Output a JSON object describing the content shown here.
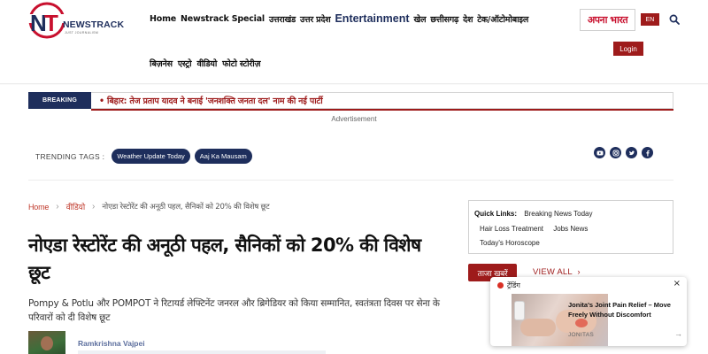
{
  "header": {
    "logo_text": "NEWSTRACK",
    "logo_tagline": "JUST JOURNALISM",
    "nav_items": [
      "Home",
      "Newstrack Special",
      "उत्तराखंड",
      "उत्तर प्रदेश",
      "Entertainment",
      "खेल",
      "छत्तीसगढ़",
      "देश",
      "टेक/ऑटोमोबाइल"
    ],
    "nav_items_row2": [
      "बिज़नेस",
      "एस्ट्रो",
      "वीडियो",
      "फोटो स्टोरीज़"
    ],
    "apna_bharat": "अपना भारत",
    "language": "EN",
    "login": "Login"
  },
  "breaking": {
    "label": "BREAKING",
    "text": "• बिहार: तेज प्रताप यादव ने बनाई 'जनशक्ति जनता दल' नाम की नई पार्टी"
  },
  "advertisement": "Advertisement",
  "trending": {
    "label": "TRENDING TAGS :",
    "tags": [
      "Weather Update Today",
      "Aaj Ka Mausam"
    ]
  },
  "socials": [
    "youtube-icon",
    "instagram-icon",
    "twitter-icon",
    "facebook-icon"
  ],
  "breadcrumb": {
    "home": "Home",
    "section": "वीडियो",
    "current": "नोएडा रेस्टोरेंट की अनूठी पहल, सैनिकों को 20% की विशेष छूट"
  },
  "article": {
    "title": "नोएडा रेस्टोरेंट की अनूठी पहल, सैनिकों को 20% की विशेष छूट",
    "summary": "Pompy & Potlu और POMPOT ने रिटायर्ड लेफ्टिनेंट जनरल और ब्रिगेडियर को किया सम्मानित, स्वतंत्रता दिवस पर सेना के परिवारों को दी विशेष छूट",
    "author": "Ramkrishna Vajpei"
  },
  "quick_links": {
    "label": "Quick Links:",
    "links": [
      "Breaking News Today",
      "Hair Loss Treatment",
      "Jobs News",
      "Today's Horoscope"
    ]
  },
  "latest": {
    "label": "ताजा खबरें",
    "view_all": "VIEW ALL"
  },
  "popup": {
    "title": "ट्रेंडिंग",
    "close": "×",
    "ad_title": "Jonita's Joint Pain Relief – Move Freely Without Discomfort",
    "brand": "JONITAS",
    "arrow": "→"
  },
  "colors": {
    "navy": "#1e2e5c",
    "maroon": "#9e1b1b",
    "crumb_red": "#c0392b"
  }
}
